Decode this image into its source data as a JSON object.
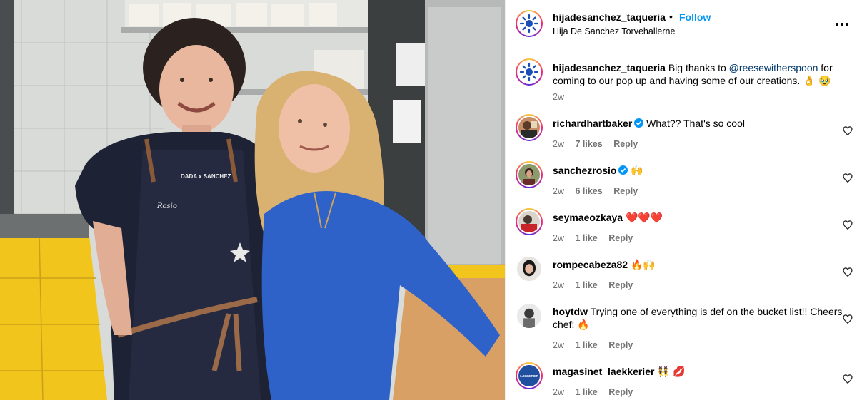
{
  "post": {
    "username": "hijadesanchez_taqueria",
    "dot": "•",
    "follow_label": "Follow",
    "location": "Hija De Sanchez Torvehallerne",
    "apron_text": "DADA x SANCHEZ",
    "apron_name": "Rosio"
  },
  "caption": {
    "username": "hijadesanchez_taqueria",
    "text_before": "Big thanks to",
    "mention": "@reesewitherspoon",
    "text_after": "for coming to our pop up and having some of our creations.",
    "emojis": "👌 🥹",
    "time": "2w"
  },
  "comments": [
    {
      "username": "richardhartbaker",
      "verified": true,
      "text": "What?? That's so cool",
      "emoji": "",
      "time": "2w",
      "likes": "7 likes",
      "reply": "Reply"
    },
    {
      "username": "sanchezrosio",
      "verified": true,
      "text": "",
      "emoji": "🙌",
      "time": "2w",
      "likes": "6 likes",
      "reply": "Reply"
    },
    {
      "username": "seymaeozkaya",
      "verified": false,
      "text": "",
      "emoji": "❤️❤️❤️",
      "time": "2w",
      "likes": "1 like",
      "reply": "Reply"
    },
    {
      "username": "rompecabeza82",
      "verified": false,
      "text": "",
      "emoji": "🔥🙌",
      "time": "2w",
      "likes": "1 like",
      "reply": "Reply"
    },
    {
      "username": "hoytdw",
      "verified": false,
      "text": "Trying one of everything is def on the bucket list!! Cheers chef!",
      "emoji": "🔥",
      "time": "2w",
      "likes": "1 like",
      "reply": "Reply"
    },
    {
      "username": "magasinet_laekkerier",
      "verified": false,
      "text": "",
      "emoji": "👯 💋",
      "time": "2w",
      "likes": "1 like",
      "reply": "Reply",
      "avatar_text": "LÆKKERIER"
    }
  ],
  "colors": {
    "link": "#0095f6",
    "mention": "#00376b",
    "meta": "#737373",
    "verified": "#0095f6"
  },
  "icons": {
    "more": "more-horizontal-icon",
    "like": "heart-outline-icon",
    "verified": "verified-badge-icon"
  }
}
